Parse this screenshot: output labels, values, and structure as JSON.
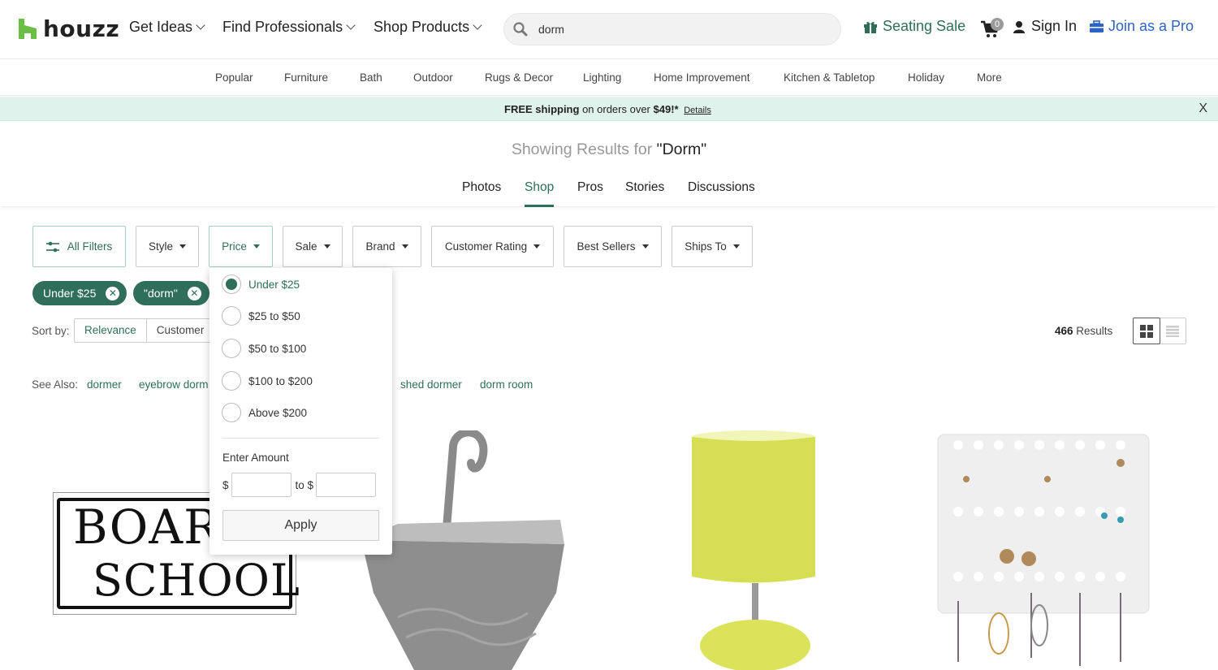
{
  "header": {
    "logo_text": "houzz",
    "nav": [
      {
        "label": "Get Ideas"
      },
      {
        "label": "Find Professionals"
      },
      {
        "label": "Shop Products"
      }
    ],
    "search": {
      "value": "dorm",
      "icon": "search-icon"
    },
    "seating_sale": "Seating Sale",
    "cart_count": "0",
    "sign_in": "Sign In",
    "join_pro": "Join as a Pro"
  },
  "categories": [
    "Popular",
    "Furniture",
    "Bath",
    "Outdoor",
    "Rugs & Decor",
    "Lighting",
    "Home Improvement",
    "Kitchen & Tabletop",
    "Holiday",
    "More"
  ],
  "promo": {
    "free": "FREE shipping",
    "middle": " on orders over ",
    "amount": "$49!*",
    "details": "Details",
    "close": "X"
  },
  "results": {
    "prefix": "Showing Results for ",
    "query": "\"Dorm\""
  },
  "tabs": [
    {
      "label": "Photos",
      "active": false
    },
    {
      "label": "Shop",
      "active": true
    },
    {
      "label": "Pros",
      "active": false
    },
    {
      "label": "Stories",
      "active": false
    },
    {
      "label": "Discussions",
      "active": false
    }
  ],
  "filters": [
    "All Filters",
    "Style",
    "Price",
    "Sale",
    "Brand",
    "Customer Rating",
    "Best Sellers",
    "Ships To"
  ],
  "chips": [
    "Under $25",
    "\"dorm\""
  ],
  "sort": {
    "label": "Sort by:",
    "options": [
      "Relevance",
      "Customer"
    ]
  },
  "result_count": "466",
  "result_label": " Results",
  "see_also": {
    "label": "See Also:",
    "links": [
      "dormer",
      "eyebrow dorm",
      "shed dormer",
      "dorm room"
    ]
  },
  "price_dropdown": {
    "options": [
      {
        "label": "Under $25",
        "checked": true
      },
      {
        "label": "$25 to $50",
        "checked": false
      },
      {
        "label": "$50 to $100",
        "checked": false
      },
      {
        "label": "$100 to $200",
        "checked": false
      },
      {
        "label": "Above $200",
        "checked": false
      }
    ],
    "enter_amount": "Enter Amount",
    "currency": "$",
    "to": "to $",
    "min_value": "",
    "max_value": "",
    "apply": "Apply"
  },
  "products": [
    {
      "name": "Boarding School sign",
      "sign_line1": "BOARD",
      "sign_line2": "SCHOOL"
    },
    {
      "name": "Gray hanging shower caddy"
    },
    {
      "name": "Yellow table lamp"
    },
    {
      "name": "Earring organizer"
    }
  ],
  "colors": {
    "brand_green": "#2e6e5a",
    "logo_green": "#6abd45",
    "pro_blue": "#2c63c6",
    "promo_bg": "#e0f2ec"
  }
}
